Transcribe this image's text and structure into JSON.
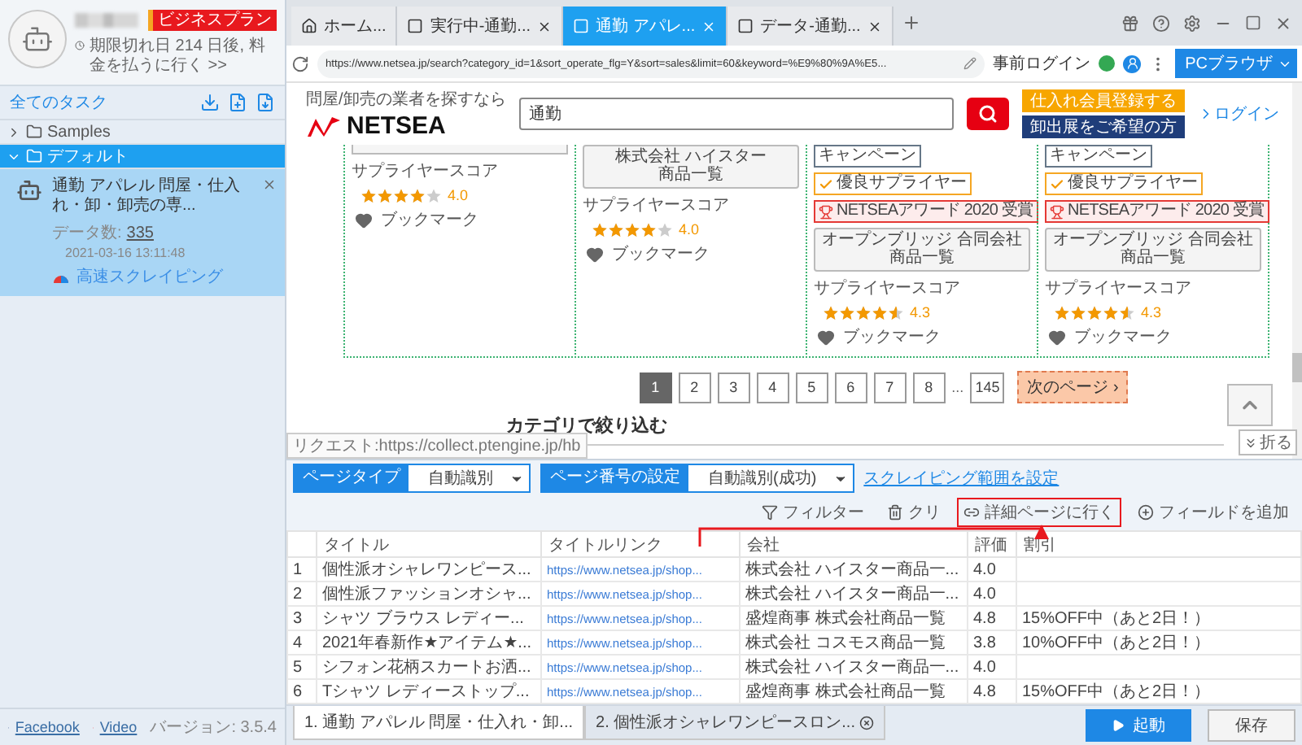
{
  "sidebar": {
    "plan_badge": "ビジネスプラン",
    "expiry": "期限切れ日 214 日後, 料金を払うに行く >>",
    "all_tasks": "全てのタスク",
    "folders": [
      {
        "label": "Samples",
        "expanded": false,
        "selected": false
      },
      {
        "label": "デフォルト",
        "expanded": true,
        "selected": true,
        "children": [
          {
            "title": "通勤 アパレル 問屋・仕入れ・卸・卸売の専...",
            "count_label": "データ数:",
            "count": "335",
            "time": "2021-03-16 13:11:48",
            "mode": "高速スクレイピング",
            "selected": true
          }
        ]
      }
    ],
    "footer_links": [
      {
        "kind": "facebook",
        "label": "Facebook"
      },
      {
        "kind": "video",
        "label": "Video"
      }
    ],
    "version": "バージョン: 3.5.4"
  },
  "browser": {
    "tabs": [
      {
        "kind": "home",
        "label": "ホーム...",
        "selected": false,
        "closable": false
      },
      {
        "kind": "page",
        "label": "実行中-通勤...",
        "selected": false,
        "closable": true
      },
      {
        "kind": "page",
        "label": "通勤 アパレ...",
        "selected": true,
        "closable": true
      },
      {
        "kind": "page",
        "label": "データ-通勤...",
        "selected": false,
        "closable": true
      }
    ],
    "url": "https://www.netsea.jp/search?category_id=1&sort_operate_flg=Y&sort=sales&limit=60&keyword=%E9%80%9A%E5...",
    "prelogin": "事前ログイン",
    "mode_button": "PCブラウザ"
  },
  "page": {
    "tagline": "問屋/卸売の業者を探すなら",
    "logo": "NETSEA",
    "search_value": "通勤",
    "register": "仕入れ会員登録する",
    "exhibit": "卸出展をご希望の方",
    "login": "ログイン",
    "cards": [
      {
        "score_label": "サプライヤースコア",
        "stars": 4,
        "score": "4.0",
        "bookmark": "ブックマーク"
      },
      {
        "company": "株式会社 ハイスター",
        "list_button": "商品一覧",
        "score_label": "サプライヤースコア",
        "stars": 4,
        "score": "4.0",
        "bookmark": "ブックマーク"
      },
      {
        "tags": [
          {
            "kind": "campaign",
            "label": "キャンペーン"
          },
          {
            "kind": "excellent",
            "label": "優良サプライヤー"
          },
          {
            "kind": "award",
            "label": "NETSEAアワード 2020 受賞"
          }
        ],
        "company": "オープンブリッジ 合同会社",
        "list_button": "商品一覧",
        "score_label": "サプライヤースコア",
        "stars": 4.5,
        "score": "4.3",
        "bookmark": "ブックマーク"
      },
      {
        "tags": [
          {
            "kind": "campaign",
            "label": "キャンペーン"
          },
          {
            "kind": "excellent",
            "label": "優良サプライヤー"
          },
          {
            "kind": "award",
            "label": "NETSEAアワード 2020 受賞"
          }
        ],
        "company": "オープンブリッジ 合同会社",
        "list_button": "商品一覧",
        "score_label": "サプライヤースコア",
        "stars": 4.5,
        "score": "4.3",
        "bookmark": "ブックマーク"
      }
    ],
    "pages": [
      {
        "label": "1",
        "selected": true
      },
      {
        "label": "2",
        "selected": false
      },
      {
        "label": "3",
        "selected": false
      },
      {
        "label": "4",
        "selected": false
      },
      {
        "label": "5",
        "selected": false
      },
      {
        "label": "6",
        "selected": false
      },
      {
        "label": "7",
        "selected": false
      },
      {
        "label": "8",
        "selected": false
      }
    ],
    "ellipsis": "...",
    "last_page": "145",
    "next_page": "次のページ ›",
    "category_heading": "カテゴリで絞り込む"
  },
  "status_request": "リクエスト:https://collect.ptengine.jp/hb",
  "collapse_button": "折る",
  "panel": {
    "selectors": [
      {
        "label": "ページタイプ",
        "value": "自動識別"
      },
      {
        "label": "ページ番号の設定",
        "value": "自動識別(成功)"
      }
    ],
    "range_link": "スクレイピング範囲を設定",
    "actions": [
      {
        "kind": "filter",
        "label": "フィルター",
        "highlighted": false
      },
      {
        "kind": "clear",
        "label": "クリ",
        "highlighted": false
      },
      {
        "kind": "detail",
        "label": "詳細ページに行く",
        "highlighted": true
      },
      {
        "kind": "add",
        "label": "フィールドを追加",
        "highlighted": false
      }
    ],
    "columns": [
      "タイトル",
      "タイトルリンク",
      "会社",
      "評価",
      "割引"
    ],
    "rows": [
      {
        "index": "1",
        "title": "個性派オシャレワンピース...",
        "link": "https://www.netsea.jp/shop...",
        "company": "株式会社 ハイスター商品一...",
        "rating": "4.0"
      },
      {
        "index": "2",
        "title": "個性派ファッションオシャ...",
        "link": "https://www.netsea.jp/shop...",
        "company": "株式会社 ハイスター商品一...",
        "rating": "4.0"
      },
      {
        "index": "3",
        "title": "シャツ ブラウス レディー...",
        "link": "https://www.netsea.jp/shop...",
        "company": "盛煌商事 株式会社商品一覧",
        "rating": "4.8",
        "discount": "15%OFF中（あと2日！）"
      },
      {
        "index": "4",
        "title": "2021年春新作★アイテム★...",
        "link": "https://www.netsea.jp/shop...",
        "company": "株式会社 コスモス商品一覧",
        "rating": "3.8",
        "discount": "10%OFF中（あと2日！）"
      },
      {
        "index": "5",
        "title": "シフォン花柄スカートお洒...",
        "link": "https://www.netsea.jp/shop...",
        "company": "株式会社 ハイスター商品一...",
        "rating": "4.0"
      },
      {
        "index": "6",
        "title": "Tシャツ レディーストップ...",
        "link": "https://www.netsea.jp/shop...",
        "company": "盛煌商事 株式会社商品一覧",
        "rating": "4.8",
        "discount": "15%OFF中（あと2日！）"
      }
    ],
    "result_tabs": [
      {
        "label": "1. 通勤 アパレル 問屋・仕入れ・卸...",
        "selected": true,
        "closable": false
      },
      {
        "label": "2. 個性派オシャレワンピースロン...",
        "selected": false,
        "closable": true
      }
    ],
    "start_button": "起動",
    "save_button": "保存"
  }
}
